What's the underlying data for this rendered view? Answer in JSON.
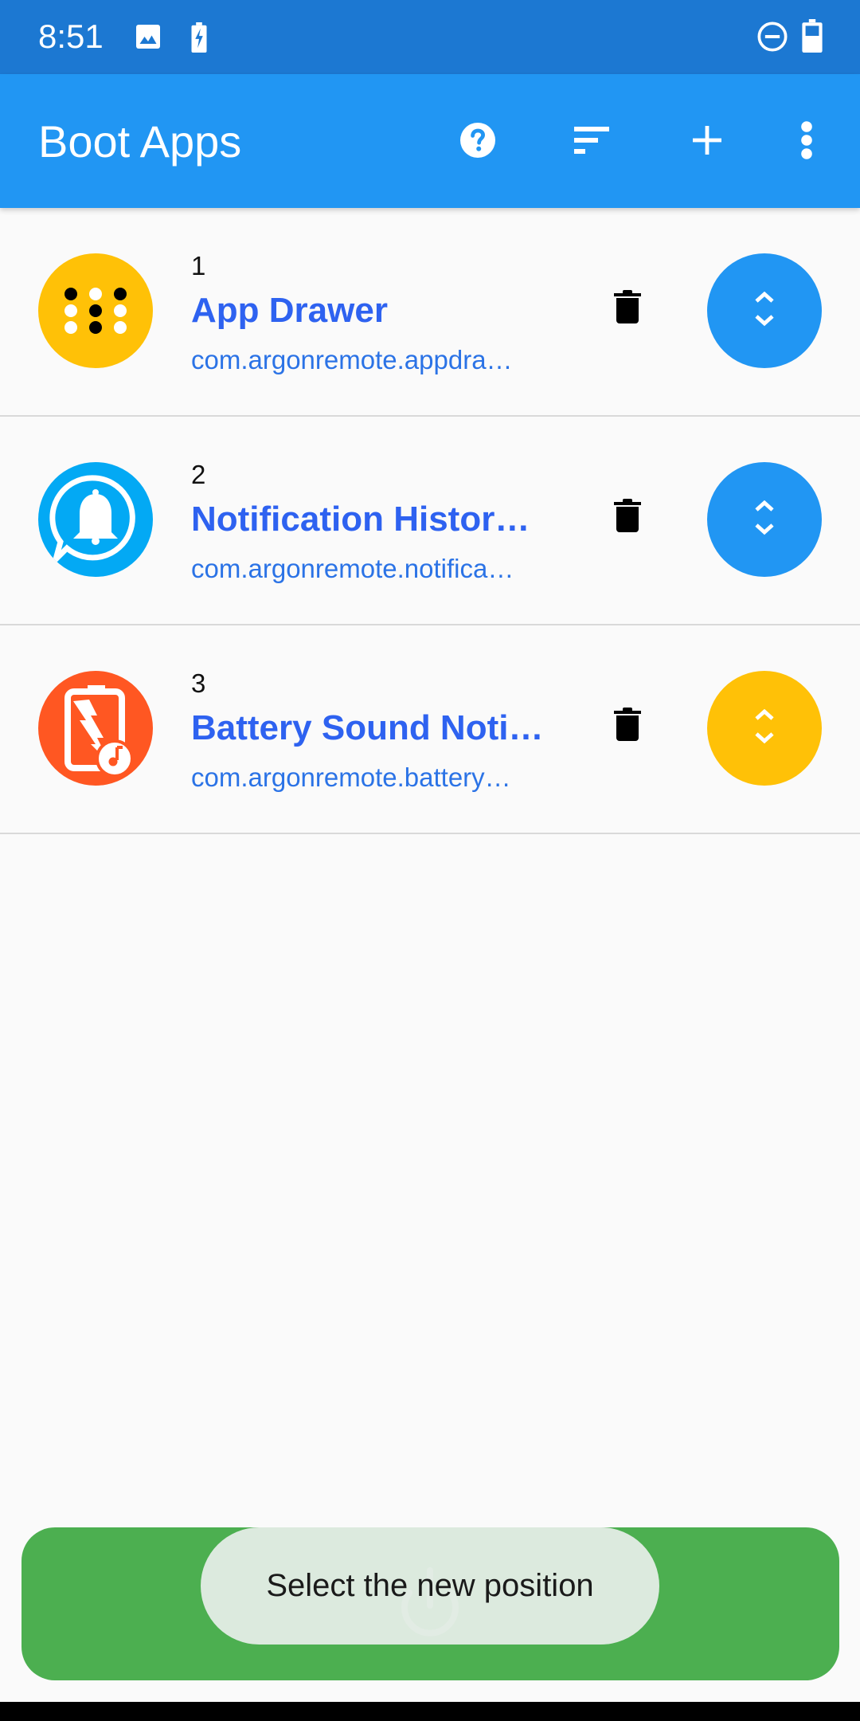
{
  "status_bar": {
    "time": "8:51",
    "left_icons": [
      "image-icon",
      "battery-charging-icon"
    ],
    "right_icons": [
      "do-not-disturb-icon",
      "battery-icon"
    ]
  },
  "app_bar": {
    "title": "Boot Apps",
    "actions": [
      {
        "name": "help",
        "icon": "help-icon"
      },
      {
        "name": "sort",
        "icon": "sort-icon"
      },
      {
        "name": "add",
        "icon": "plus-icon"
      },
      {
        "name": "more",
        "icon": "more-vert-icon"
      }
    ]
  },
  "apps": [
    {
      "index": "1",
      "name": "App Drawer",
      "package": "com.argonremote.appdra…",
      "icon": "app-drawer-icon",
      "icon_color": "#ffc107",
      "handle_color": "#2196f3"
    },
    {
      "index": "2",
      "name": "Notification Histor…",
      "package": "com.argonremote.notifica…",
      "icon": "notification-bell-icon",
      "icon_color": "#03a9f4",
      "handle_color": "#2196f3"
    },
    {
      "index": "3",
      "name": "Battery Sound Noti…",
      "package": "com.argonremote.battery…",
      "icon": "battery-sound-icon",
      "icon_color": "#ff5722",
      "handle_color": "#ffc107"
    }
  ],
  "bottom_bar": {
    "icon": "power-icon",
    "color": "#4caf50"
  },
  "toast": {
    "message": "Select the new position"
  }
}
